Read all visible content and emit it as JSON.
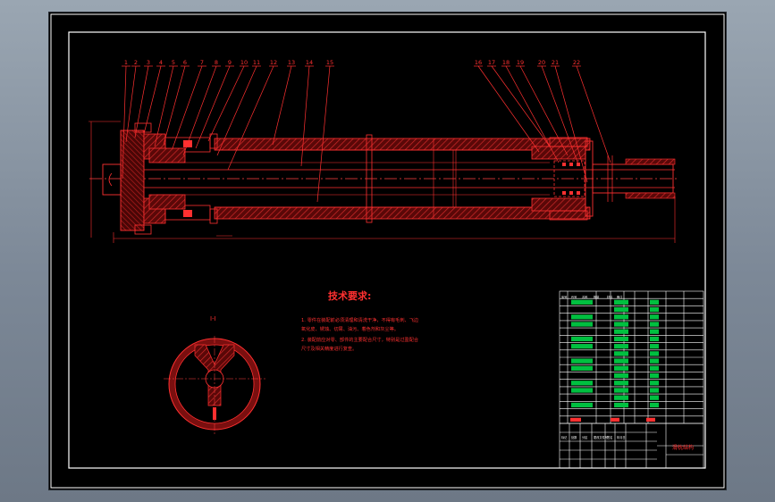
{
  "part_numbers": [
    "1",
    "2",
    "3",
    "4",
    "5",
    "6",
    "7",
    "8",
    "9",
    "10",
    "11",
    "12",
    "13",
    "14",
    "15",
    "16",
    "17",
    "18",
    "19",
    "20",
    "21",
    "22"
  ],
  "tech_title": "技术要求:",
  "tech_notes": [
    "1. 零件在装配前必须清理和清洗干净，不得有毛刺、飞边",
    "   氧化皮、锈蚀、切屑、油污、着色剂和灰尘等。",
    "2. 装配前应对零、部件的主要配合尺寸，特别是过盈配合",
    "   尺寸及相关精度进行复查。"
  ],
  "section_label": "I-I",
  "title_block": {
    "drawing_name": "滑枕结构",
    "header_cells": [
      "序号",
      "代号",
      "名称",
      "数量",
      "材料",
      "备注"
    ],
    "row_cells": [
      "标记",
      "处数",
      "分区",
      "更改文件号",
      "签名",
      "年月日"
    ]
  },
  "colors": {
    "background": "#000000",
    "frame": "#ffffff",
    "part_line": "#ff2020",
    "hatch": "#c02020",
    "note_text": "#ff3030",
    "bom_text": "#00e040"
  }
}
